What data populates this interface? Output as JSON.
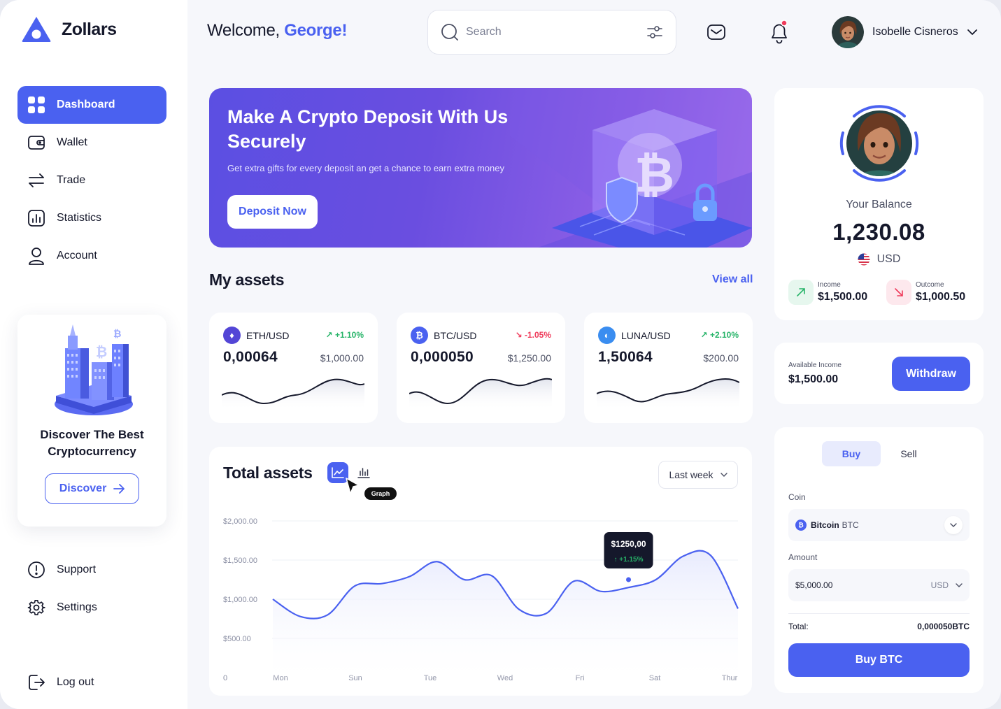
{
  "brand": {
    "name": "Zollars"
  },
  "sidebar": {
    "items": [
      {
        "label": "Dashboard",
        "icon": "grid-icon",
        "active": true
      },
      {
        "label": "Wallet",
        "icon": "wallet-icon",
        "active": false
      },
      {
        "label": "Trade",
        "icon": "swap-icon",
        "active": false
      },
      {
        "label": "Statistics",
        "icon": "chart-icon",
        "active": false
      },
      {
        "label": "Account",
        "icon": "user-icon",
        "active": false
      }
    ],
    "promo": {
      "title": "Discover The Best Cryptocurrency",
      "button": "Discover"
    },
    "bottom": [
      {
        "label": "Support",
        "icon": "alert-circle-icon"
      },
      {
        "label": "Settings",
        "icon": "gear-icon"
      }
    ],
    "logout": "Log out"
  },
  "header": {
    "welcome_prefix": "Welcome,",
    "welcome_name": "George!",
    "search_placeholder": "Search",
    "user_name": "Isobelle Cisneros"
  },
  "banner": {
    "title": "Make A Crypto Deposit With Us Securely",
    "subtitle": "Get extra gifts for every deposit an get a chance to earn extra money",
    "button": "Deposit Now"
  },
  "assets": {
    "title": "My assets",
    "view_all": "View all",
    "cards": [
      {
        "pair": "ETH/USD",
        "change": "+1.10%",
        "direction": "up",
        "value": "0,00064",
        "usd": "$1,000.00",
        "coin_color": "#5346d6",
        "coin_glyph": "♦"
      },
      {
        "pair": "BTC/USD",
        "change": "-1.05%",
        "direction": "down",
        "value": "0,000050",
        "usd": "$1,250.00",
        "coin_color": "#4a61f0",
        "coin_glyph": "₿"
      },
      {
        "pair": "LUNA/USD",
        "change": "+2.10%",
        "direction": "up",
        "value": "1,50064",
        "usd": "$200.00",
        "coin_color": "#3a8df0",
        "coin_glyph": "◐"
      }
    ]
  },
  "total_assets": {
    "title": "Total assets",
    "graph_tooltip": "Graph",
    "period": "Last week",
    "tooltip_value": "$1250,00",
    "tooltip_change": "↑ +1.15%"
  },
  "chart_data": {
    "type": "line",
    "categories": [
      "Mon",
      "Sun",
      "Tue",
      "Wed",
      "Fri",
      "Sat",
      "Thur"
    ],
    "y_ticks": [
      "$2,000.00",
      "$1,500.00",
      "$1,000.00",
      "$500.00",
      "0"
    ],
    "ylim": [
      0,
      2000
    ],
    "series": [
      {
        "values": [
          1000,
          780,
          800,
          1170,
          1200,
          1290,
          1480,
          1250,
          1300,
          870,
          820,
          1230,
          1100,
          1150,
          1250,
          1550,
          1560,
          880
        ]
      }
    ],
    "highlight": {
      "value": 1250,
      "label": "$1250,00",
      "change": "+1.15%"
    },
    "colors": {
      "line": "#4a61f0",
      "fill": "#e8ebfd"
    }
  },
  "balance": {
    "label": "Your Balance",
    "value": "1,230.08",
    "currency": "USD",
    "income_label": "Income",
    "income_value": "$1,500.00",
    "outcome_label": "Outcome",
    "outcome_value": "$1,000.50"
  },
  "withdraw": {
    "label": "Available Income",
    "value": "$1,500.00",
    "button": "Withdraw"
  },
  "trade": {
    "tab_buy": "Buy",
    "tab_sell": "Sell",
    "coin_label": "Coin",
    "coin_name": "Bitcoin",
    "coin_ticker": "BTC",
    "amount_label": "Amount",
    "amount_value": "$5,000.00",
    "amount_currency": "USD",
    "total_label": "Total:",
    "total_value": "0,000050BTC",
    "button": "Buy BTC"
  },
  "colors": {
    "accent": "#4a61f0",
    "up": "#27b469",
    "down": "#ef3b5b"
  }
}
